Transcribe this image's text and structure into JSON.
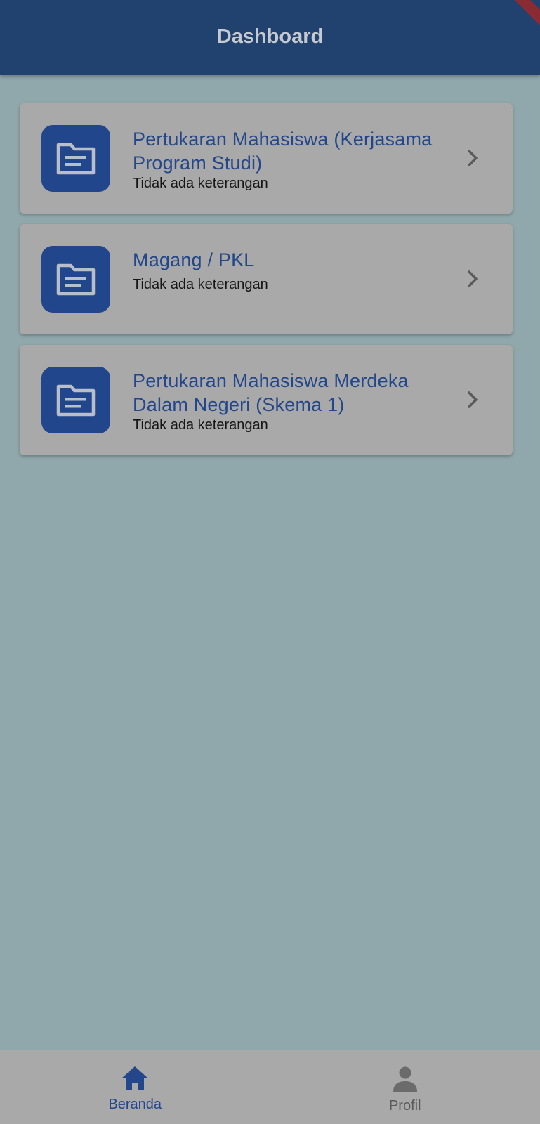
{
  "appbar": {
    "title": "Dashboard"
  },
  "programs": [
    {
      "title": "Pertukaran Mahasiswa (Kerjasama Program Studi)",
      "subtitle": "Tidak ada keterangan",
      "icon": "folder-document-icon"
    },
    {
      "title": "Magang / PKL",
      "subtitle": "Tidak ada keterangan",
      "icon": "folder-document-icon"
    },
    {
      "title": "Pertukaran Mahasiswa Merdeka Dalam Negeri (Skema 1)",
      "subtitle": "Tidak ada keterangan",
      "icon": "folder-document-icon"
    }
  ],
  "bottom_nav": {
    "items": [
      {
        "label": "Beranda",
        "icon": "home-icon",
        "active": true
      },
      {
        "label": "Profil",
        "icon": "person-icon",
        "active": false
      }
    ]
  },
  "colors": {
    "primary": "#21426f",
    "icon_bg": "#21468b",
    "title_text": "#23478a",
    "background": "#90a7ab",
    "card": "#a9a9a9"
  }
}
